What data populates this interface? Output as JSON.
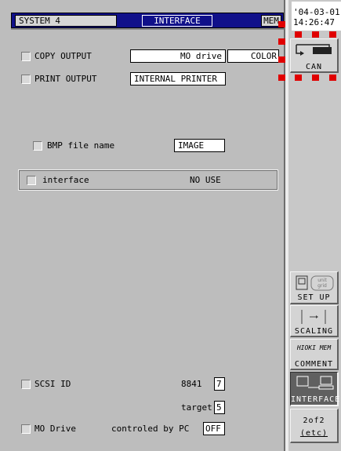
{
  "title_bar": {
    "system": "SYSTEM 4",
    "screen": "INTERFACE",
    "mem": "MEM"
  },
  "copy_output": {
    "label": "COPY OUTPUT",
    "device": "MO drive",
    "mode": "COLOR"
  },
  "print_output": {
    "label": "PRINT OUTPUT",
    "printer": "INTERNAL PRINTER"
  },
  "bmp": {
    "label": "BMP file name",
    "value": "IMAGE"
  },
  "interface": {
    "label": "interface",
    "value": "NO USE"
  },
  "scsi": {
    "label": "SCSI ID",
    "model": "8841",
    "model_value": "7",
    "target_label": "target",
    "target_value": "5"
  },
  "mo_drive": {
    "label": "MO Drive",
    "desc": "controled by PC",
    "value": "OFF"
  },
  "datetime": {
    "date": "'04-03-01",
    "time": "14:26:47"
  },
  "side_buttons": {
    "can": "CAN",
    "setup": "SET UP",
    "scaling": "SCALING",
    "comment": "COMMENT",
    "comment_icon": "HIOKI MEM",
    "interface": "INTERFACE",
    "page": "2of2",
    "etc": "(etc)"
  },
  "colors": {
    "title_bg": "#10108a",
    "selected": "#606060",
    "marker": "#e00000"
  }
}
